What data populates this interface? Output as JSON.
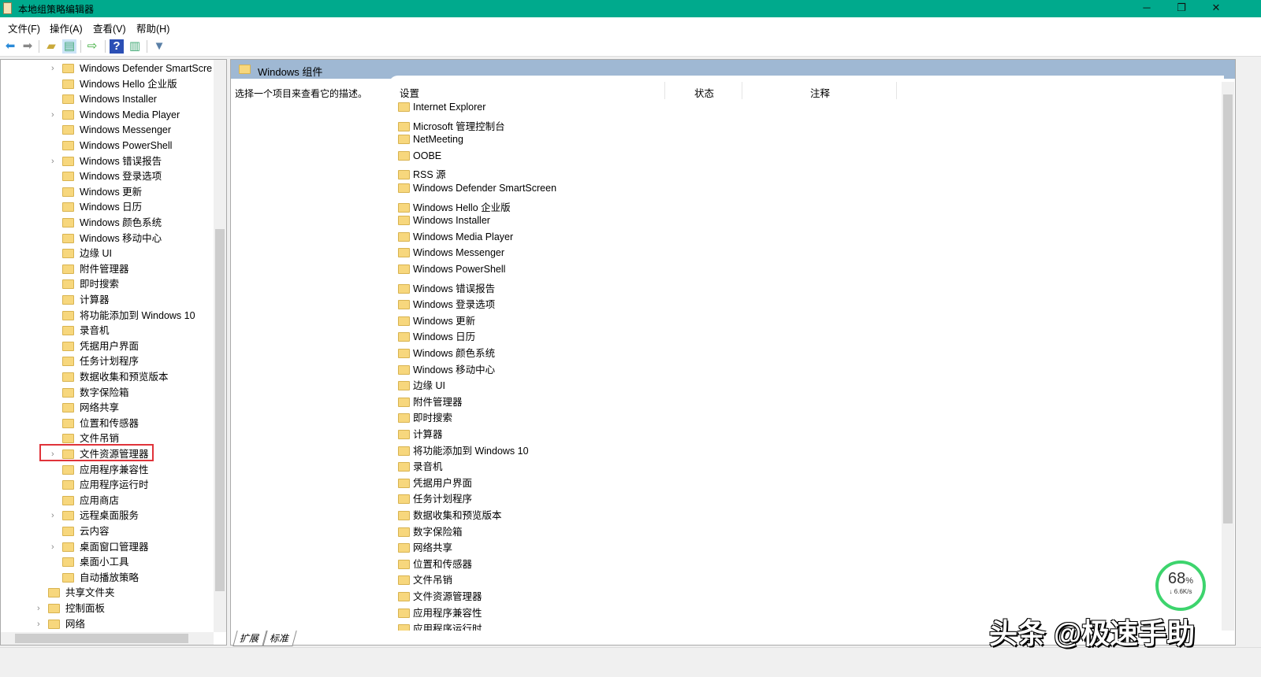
{
  "window": {
    "title": "本地组策略编辑器",
    "minimize": "─",
    "restore": "❐",
    "close": "✕"
  },
  "menu": [
    "文件(F)",
    "操作(A)",
    "查看(V)",
    "帮助(H)"
  ],
  "tree": [
    {
      "label": "Windows Defender SmartScre",
      "expandable": true,
      "level": 2
    },
    {
      "label": "Windows Hello 企业版",
      "expandable": false,
      "level": 2
    },
    {
      "label": "Windows Installer",
      "expandable": false,
      "level": 2
    },
    {
      "label": "Windows Media Player",
      "expandable": true,
      "level": 2
    },
    {
      "label": "Windows Messenger",
      "expandable": false,
      "level": 2
    },
    {
      "label": "Windows PowerShell",
      "expandable": false,
      "level": 2
    },
    {
      "label": "Windows 错误报告",
      "expandable": true,
      "level": 2
    },
    {
      "label": "Windows 登录选项",
      "expandable": false,
      "level": 2
    },
    {
      "label": "Windows 更新",
      "expandable": false,
      "level": 2
    },
    {
      "label": "Windows 日历",
      "expandable": false,
      "level": 2
    },
    {
      "label": "Windows 颜色系统",
      "expandable": false,
      "level": 2
    },
    {
      "label": "Windows 移动中心",
      "expandable": false,
      "level": 2
    },
    {
      "label": "边缘 UI",
      "expandable": false,
      "level": 2
    },
    {
      "label": "附件管理器",
      "expandable": false,
      "level": 2
    },
    {
      "label": "即时搜索",
      "expandable": false,
      "level": 2
    },
    {
      "label": "计算器",
      "expandable": false,
      "level": 2
    },
    {
      "label": "将功能添加到 Windows 10",
      "expandable": false,
      "level": 2
    },
    {
      "label": "录音机",
      "expandable": false,
      "level": 2
    },
    {
      "label": "凭据用户界面",
      "expandable": false,
      "level": 2
    },
    {
      "label": "任务计划程序",
      "expandable": false,
      "level": 2
    },
    {
      "label": "数据收集和预览版本",
      "expandable": false,
      "level": 2
    },
    {
      "label": "数字保险箱",
      "expandable": false,
      "level": 2
    },
    {
      "label": "网络共享",
      "expandable": false,
      "level": 2
    },
    {
      "label": "位置和传感器",
      "expandable": false,
      "level": 2
    },
    {
      "label": "文件吊销",
      "expandable": false,
      "level": 2
    },
    {
      "label": "文件资源管理器",
      "expandable": true,
      "level": 2,
      "highlighted": true
    },
    {
      "label": "应用程序兼容性",
      "expandable": false,
      "level": 2
    },
    {
      "label": "应用程序运行时",
      "expandable": false,
      "level": 2
    },
    {
      "label": "应用商店",
      "expandable": false,
      "level": 2
    },
    {
      "label": "远程桌面服务",
      "expandable": true,
      "level": 2
    },
    {
      "label": "云内容",
      "expandable": false,
      "level": 2
    },
    {
      "label": "桌面窗口管理器",
      "expandable": true,
      "level": 2
    },
    {
      "label": "桌面小工具",
      "expandable": false,
      "level": 2
    },
    {
      "label": "自动播放策略",
      "expandable": false,
      "level": 2
    },
    {
      "label": "共享文件夹",
      "expandable": false,
      "level": 1
    },
    {
      "label": "控制面板",
      "expandable": true,
      "level": 1
    },
    {
      "label": "网络",
      "expandable": true,
      "level": 1
    }
  ],
  "right": {
    "header": "Windows 组件",
    "description": "选择一个项目来查看它的描述。",
    "columns": [
      "设置",
      "状态",
      "注释"
    ],
    "items": [
      "Internet Explorer",
      "Microsoft 管理控制台",
      "NetMeeting",
      "OOBE",
      "RSS 源",
      "Windows Defender SmartScreen",
      "Windows Hello 企业版",
      "Windows Installer",
      "Windows Media Player",
      "Windows Messenger",
      "Windows PowerShell",
      "Windows 错误报告",
      "Windows 登录选项",
      "Windows 更新",
      "Windows 日历",
      "Windows 颜色系统",
      "Windows 移动中心",
      "边缘 UI",
      "附件管理器",
      "即时搜索",
      "计算器",
      "将功能添加到 Windows 10",
      "录音机",
      "凭据用户界面",
      "任务计划程序",
      "数据收集和预览版本",
      "数字保险箱",
      "网络共享",
      "位置和传感器",
      "文件吊销",
      "文件资源管理器",
      "应用程序兼容性",
      "应用程序运行时"
    ],
    "tabs": [
      "扩展",
      "标准"
    ]
  },
  "widget": {
    "percent": "68",
    "unit": "%",
    "speed": "↓ 6.6K/s",
    "progress": 0.68
  },
  "watermark": "头条 @极速手助"
}
